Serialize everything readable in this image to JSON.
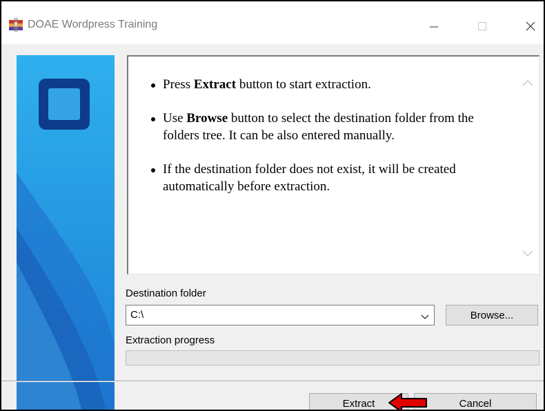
{
  "window": {
    "title": "DOAE Wordpress Training"
  },
  "titlebar": {
    "icons": {
      "app": "winrar-archive-icon",
      "minimize": "minimize-icon",
      "maximize": "maximize-icon",
      "close": "close-icon"
    }
  },
  "info": {
    "items": [
      {
        "pre": "Press ",
        "bold": "Extract",
        "post": " button to start extraction."
      },
      {
        "pre": "Use ",
        "bold": "Browse",
        "post": " button to select the destination folder from the folders tree. It can be also entered manually."
      },
      {
        "pre": "If the destination folder does not exist, it will be created automatically before extraction.",
        "bold": "",
        "post": ""
      }
    ]
  },
  "destination": {
    "label": "Destination folder",
    "value": "C:\\",
    "browse_label": "Browse..."
  },
  "progress": {
    "label": "Extraction progress",
    "value": 0
  },
  "footer": {
    "extract_label": "Extract",
    "cancel_label": "Cancel"
  },
  "colors": {
    "banner_light": "#35a8e6",
    "banner_dark": "#1565c0",
    "logo_square": "#0d3c8a",
    "arrow_red": "#e10000"
  }
}
